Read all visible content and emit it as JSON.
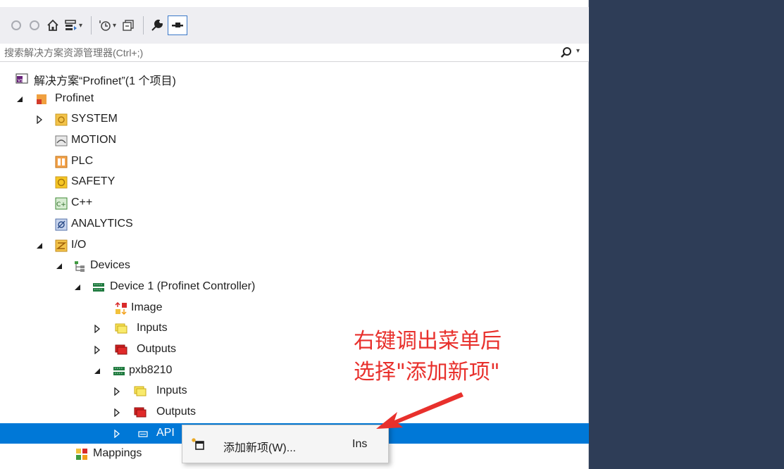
{
  "toolbar": {
    "icons": [
      "back-icon",
      "forward-icon",
      "home-icon",
      "sync-icon",
      "history-icon",
      "collapse-all-icon",
      "properties-icon",
      "pin-icon"
    ]
  },
  "search": {
    "placeholder": "搜索解决方案资源管理器(Ctrl+;)"
  },
  "tree": {
    "solution": "解决方案“Profinet”(1 个项目)",
    "project": "Profinet",
    "system": "SYSTEM",
    "motion": "MOTION",
    "plc": "PLC",
    "safety": "SAFETY",
    "cpp": "C++",
    "analytics": "ANALYTICS",
    "io": "I/O",
    "devices": "Devices",
    "device1": "Device 1 (Profinet Controller)",
    "image": "Image",
    "inputs": "Inputs",
    "outputs": "Outputs",
    "pxb": "pxb8210",
    "pxb_inputs": "Inputs",
    "pxb_outputs": "Outputs",
    "api": "API",
    "mappings": "Mappings"
  },
  "context_menu": {
    "item_label": "添加新项(W)...",
    "item_shortcut": "Ins"
  },
  "annotation": {
    "line1": "右键调出菜单后",
    "line2": "选择\"添加新项\""
  },
  "colors": {
    "selection": "#0078d7",
    "annotation": "#e8302c",
    "right_pane": "#2e3d57",
    "toolbar": "#eeeef2"
  }
}
